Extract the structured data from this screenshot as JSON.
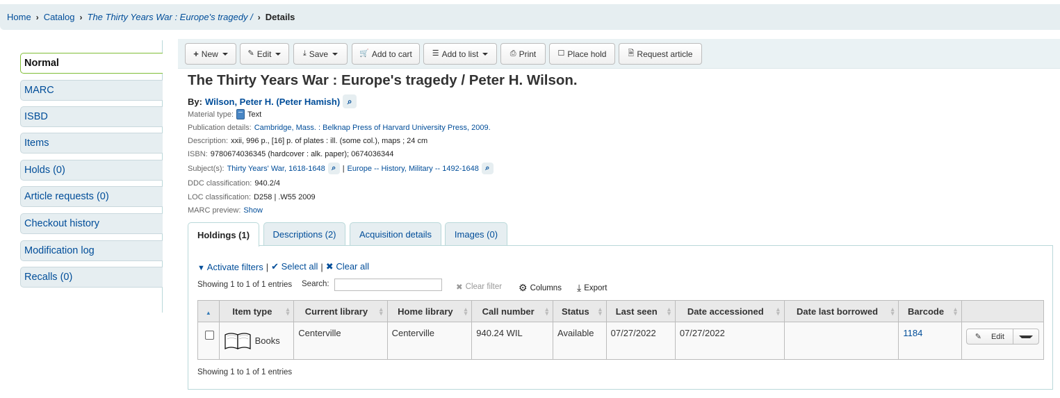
{
  "breadcrumb": {
    "items": [
      "Home",
      "Catalog",
      "The Thirty Years War : Europe's tragedy /"
    ],
    "current": "Details"
  },
  "sidebar": {
    "items": [
      {
        "label": "Normal",
        "active": true
      },
      {
        "label": "MARC"
      },
      {
        "label": "ISBD"
      },
      {
        "label": "Items"
      },
      {
        "label": "Holds (0)"
      },
      {
        "label": "Article requests (0)"
      },
      {
        "label": "Checkout history"
      },
      {
        "label": "Modification log"
      },
      {
        "label": "Recalls (0)"
      }
    ]
  },
  "toolbar": {
    "new": "New",
    "edit": "Edit",
    "save": "Save",
    "add_to_cart": "Add to cart",
    "add_to_list": "Add to list",
    "print": "Print",
    "place_hold": "Place hold",
    "request_article": "Request article"
  },
  "record": {
    "title": "The Thirty Years War : Europe's tragedy / Peter H. Wilson.",
    "by_label": "By:",
    "author": "Wilson, Peter H. (Peter Hamish)",
    "material_type_label": "Material type:",
    "material_type": "Text",
    "publication_label": "Publication details:",
    "publication": "Cambridge, Mass. : Belknap Press of Harvard University Press, 2009.",
    "description_label": "Description:",
    "description": "xxii, 996 p., [16] p. of plates : ill. (some col.), maps ; 24 cm",
    "isbn_label": "ISBN:",
    "isbn": "9780674036345 (hardcover : alk. paper); 0674036344",
    "subjects_label": "Subject(s):",
    "subjects": [
      "Thirty Years' War, 1618-1648",
      "Europe -- History, Military -- 1492-1648"
    ],
    "subject_separator": "|",
    "ddc_label": "DDC classification:",
    "ddc": "940.2/4",
    "loc_label": "LOC classification:",
    "loc": "D258 | .W55 2009",
    "marc_preview_label": "MARC preview:",
    "marc_preview_link": "Show"
  },
  "tabs": [
    {
      "label": "Holdings (1)",
      "active": true
    },
    {
      "label": "Descriptions (2)"
    },
    {
      "label": "Acquisition details"
    },
    {
      "label": "Images (0)"
    }
  ],
  "holdings": {
    "activate_filters": "Activate filters",
    "select_all": "Select all",
    "clear_all": "Clear all",
    "separator": "|",
    "info_top": "Showing 1 to 1 of 1 entries",
    "info_bottom": "Showing 1 to 1 of 1 entries",
    "search_label": "Search:",
    "search_value": "",
    "clear_filter": "Clear filter",
    "columns": "Columns",
    "export": "Export",
    "headers": [
      "Item type",
      "Current library",
      "Home library",
      "Call number",
      "Status",
      "Last seen",
      "Date accessioned",
      "Date last borrowed",
      "Barcode"
    ],
    "rows": [
      {
        "item_type": "Books",
        "current_library": "Centerville",
        "home_library": "Centerville",
        "call_number": "940.24 WIL",
        "status": "Available",
        "last_seen": "07/27/2022",
        "date_accessioned": "07/27/2022",
        "date_last_borrowed": "",
        "barcode": "1184",
        "edit_label": "Edit"
      }
    ]
  },
  "colors": {
    "link": "#004d99",
    "breadcrumb_bg": "#e6eef1",
    "active_sidebar_border": "#7fbd36",
    "panel_border": "#b9d8d9"
  }
}
